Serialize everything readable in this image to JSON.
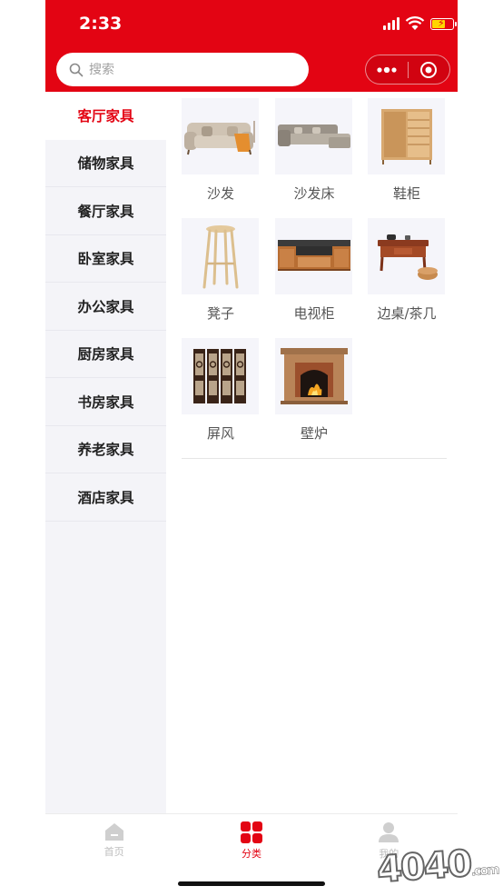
{
  "status_bar": {
    "time": "2:33"
  },
  "header": {
    "search_placeholder": "搜索",
    "capsule_more_icon": "more-dots-icon",
    "capsule_close_icon": "target-icon"
  },
  "sidebar": {
    "items": [
      {
        "label": "客厅家具",
        "active": true
      },
      {
        "label": "储物家具",
        "active": false
      },
      {
        "label": "餐厅家具",
        "active": false
      },
      {
        "label": "卧室家具",
        "active": false
      },
      {
        "label": "办公家具",
        "active": false
      },
      {
        "label": "厨房家具",
        "active": false
      },
      {
        "label": "书房家具",
        "active": false
      },
      {
        "label": "养老家具",
        "active": false
      },
      {
        "label": "酒店家具",
        "active": false
      }
    ]
  },
  "products": [
    {
      "label": "沙发",
      "icon": "sofa-image"
    },
    {
      "label": "沙发床",
      "icon": "sofa-bed-image"
    },
    {
      "label": "鞋柜",
      "icon": "shoe-cabinet-image"
    },
    {
      "label": "凳子",
      "icon": "stool-image"
    },
    {
      "label": "电视柜",
      "icon": "tv-cabinet-image"
    },
    {
      "label": "边桌/茶几",
      "icon": "side-table-image"
    },
    {
      "label": "屏风",
      "icon": "folding-screen-image"
    },
    {
      "label": "壁炉",
      "icon": "fireplace-image"
    }
  ],
  "tabbar": {
    "items": [
      {
        "label": "首页",
        "icon": "home-icon",
        "active": false
      },
      {
        "label": "分类",
        "icon": "category-icon",
        "active": true
      },
      {
        "label": "我的",
        "icon": "user-icon",
        "active": false
      }
    ]
  },
  "watermark": {
    "text": "4040",
    "suffix": ".com"
  },
  "colors": {
    "accent": "#e30413",
    "sidebar_bg": "#f4f4f8",
    "thumb_bg": "#f5f5fa"
  }
}
